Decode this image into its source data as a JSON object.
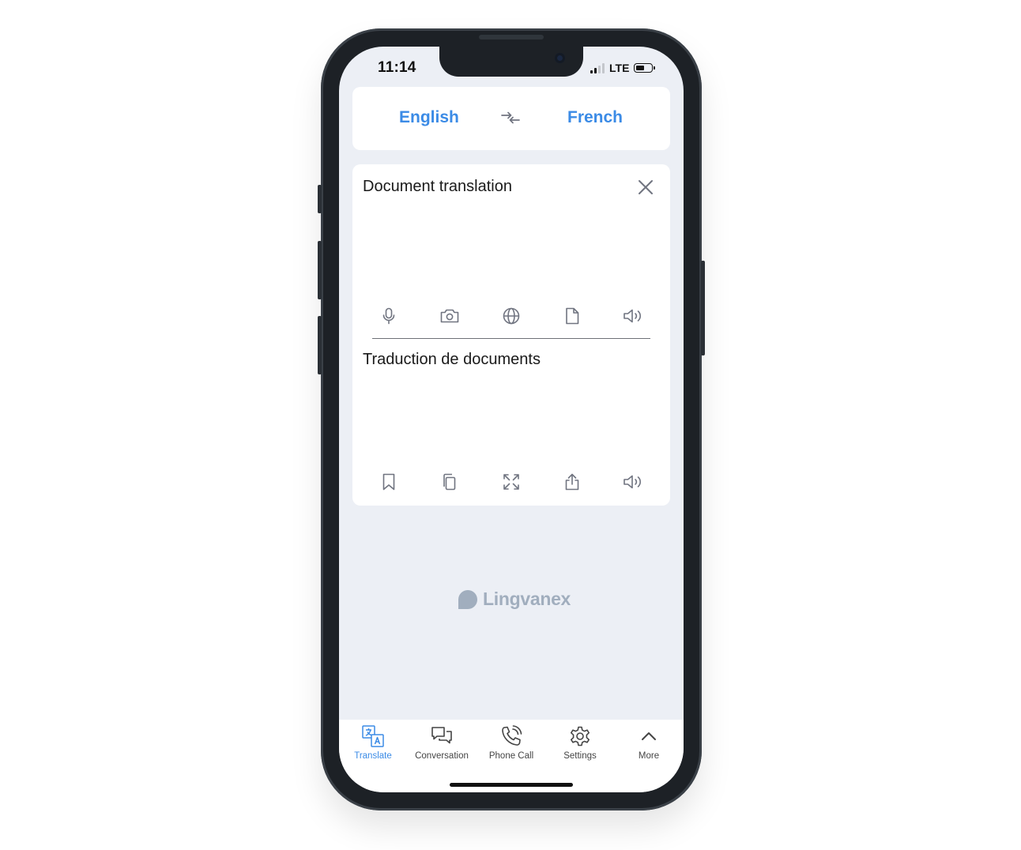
{
  "status_bar": {
    "time": "11:14",
    "network": "LTE"
  },
  "languages": {
    "source": "English",
    "target": "French"
  },
  "source_panel": {
    "text": "Document translation",
    "tools": [
      "microphone-icon",
      "camera-icon",
      "globe-icon",
      "document-icon",
      "speaker-icon"
    ]
  },
  "target_panel": {
    "text": "Traduction de documents",
    "tools": [
      "bookmark-icon",
      "copy-icon",
      "expand-icon",
      "share-icon",
      "speaker-icon"
    ]
  },
  "brand": {
    "name": "Lingvanex"
  },
  "tabs": [
    {
      "label": "Translate",
      "icon": "translate-icon",
      "active": true
    },
    {
      "label": "Conversation",
      "icon": "conversation-icon",
      "active": false
    },
    {
      "label": "Phone Call",
      "icon": "phone-call-icon",
      "active": false
    },
    {
      "label": "Settings",
      "icon": "settings-icon",
      "active": false
    },
    {
      "label": "More",
      "icon": "chevron-up-icon",
      "active": false
    }
  ],
  "colors": {
    "accent": "#3b8be6",
    "screen_bg": "#eceff5",
    "icon_gray": "#707480",
    "brand_gray": "#a1aebe"
  }
}
